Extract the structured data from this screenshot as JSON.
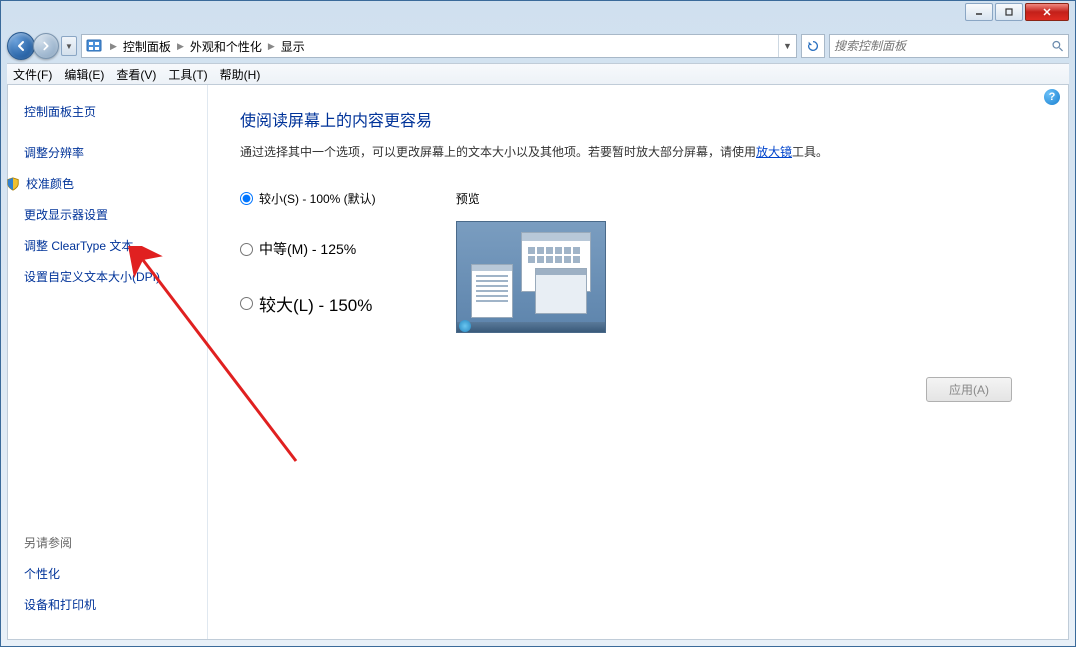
{
  "window": {
    "minimize": "min",
    "maximize": "max",
    "close": "close"
  },
  "breadcrumb": {
    "items": [
      "控制面板",
      "外观和个性化",
      "显示"
    ]
  },
  "search": {
    "placeholder": "搜索控制面板"
  },
  "menu": {
    "items": [
      {
        "label": "文件(F)"
      },
      {
        "label": "编辑(E)"
      },
      {
        "label": "查看(V)"
      },
      {
        "label": "工具(T)"
      },
      {
        "label": "帮助(H)"
      }
    ]
  },
  "sidebar": {
    "items": [
      {
        "label": "控制面板主页"
      },
      {
        "label": "调整分辨率"
      },
      {
        "label": "校准颜色",
        "shield": true
      },
      {
        "label": "更改显示器设置"
      },
      {
        "label": "调整 ClearType 文本"
      },
      {
        "label": "设置自定义文本大小(DPI)"
      }
    ],
    "seeAlsoHeading": "另请参阅",
    "seeAlso": [
      {
        "label": "个性化"
      },
      {
        "label": "设备和打印机"
      }
    ]
  },
  "main": {
    "title": "使阅读屏幕上的内容更容易",
    "descPrefix": "通过选择其中一个选项，可以更改屏幕上的文本大小以及其他项。若要暂时放大部分屏幕，请使用",
    "descLink": "放大镜",
    "descSuffix": "工具。",
    "options": [
      {
        "label": "较小(S) - 100% (默认)",
        "size": "small",
        "checked": true
      },
      {
        "label": "中等(M) - 125%",
        "size": "medium",
        "checked": false
      },
      {
        "label": "较大(L) - 150%",
        "size": "large",
        "checked": false
      }
    ],
    "previewLabel": "预览",
    "applyLabel": "应用(A)"
  }
}
